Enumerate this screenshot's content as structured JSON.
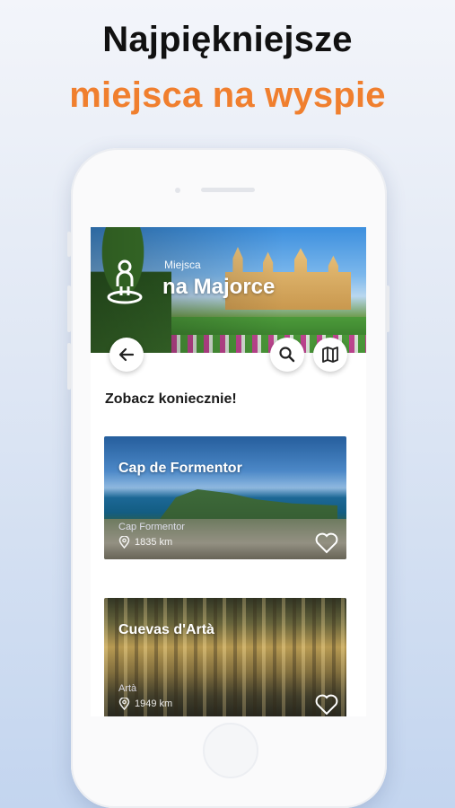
{
  "headline": {
    "line1": "Najpiękniejsze",
    "line2": "miejsca na wyspie",
    "line1_color": "#111111",
    "line2_color": "#f07f2e"
  },
  "hero": {
    "subtitle": "Miejsca",
    "title": "na Majorce",
    "icon": "map-pin-person-icon"
  },
  "actions": {
    "back": "arrow-left-icon",
    "search": "search-icon",
    "map": "map-icon"
  },
  "section_title": "Zobacz koniecznie!",
  "places": [
    {
      "title": "Cap de Formentor",
      "subtitle": "Cap Formentor",
      "distance": "1835 km",
      "favorite_icon": "heart-outline-icon"
    },
    {
      "title": "Cuevas d'Artà",
      "subtitle": "Artà",
      "distance": "1949 km",
      "favorite_icon": "heart-outline-icon"
    }
  ]
}
